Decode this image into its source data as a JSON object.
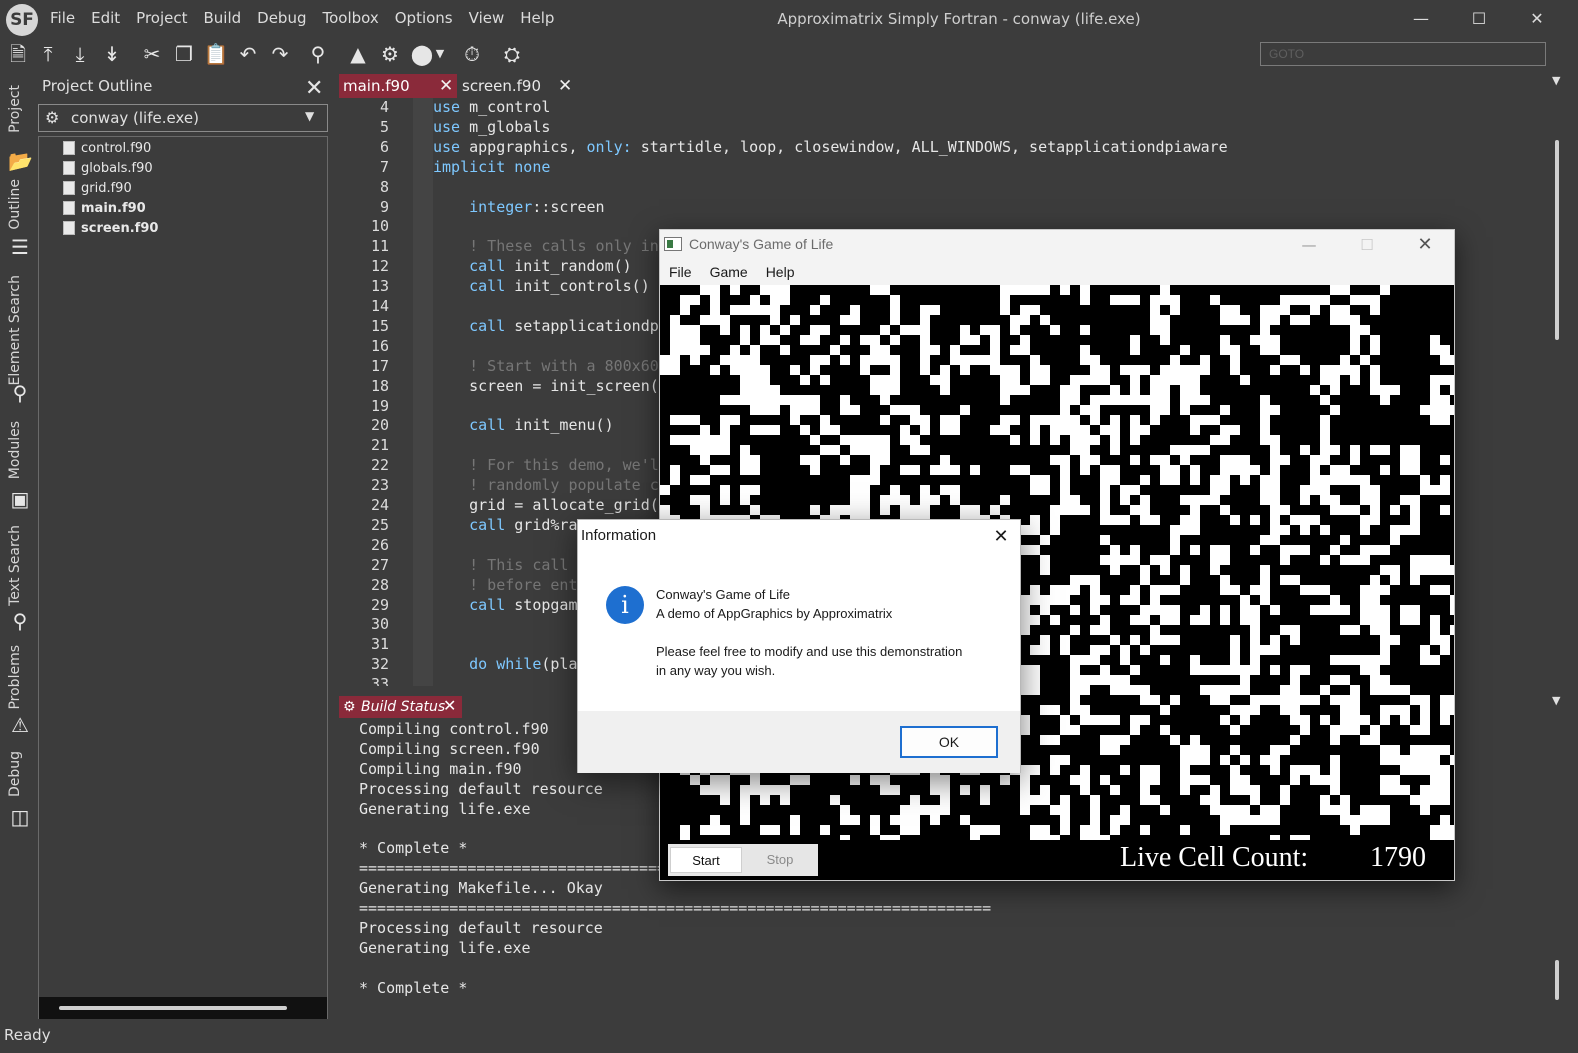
{
  "app": {
    "logo_text": "SF",
    "window_title": "Approximatrix Simply Fortran - conway (life.exe)",
    "menu": [
      "File",
      "Edit",
      "Project",
      "Build",
      "Debug",
      "Toolbox",
      "Options",
      "View",
      "Help"
    ],
    "goto_placeholder": "GOTO",
    "status": "Ready",
    "colors": {
      "background": "#3c3c3c",
      "active_tab": "#8a2a3a",
      "keyword": "#7ec8ff",
      "comment": "#767676"
    }
  },
  "toolbar": {
    "icons": [
      "new-file-icon",
      "upload-icon",
      "download-icon",
      "download-all-icon",
      "cut-icon",
      "copy-icon",
      "paste-icon",
      "undo-icon",
      "redo-icon",
      "search-icon",
      "clean-icon",
      "build-gear-icon",
      "stop-icon",
      "dropdown-arrow-icon",
      "run-icon",
      "debug-bug-icon"
    ]
  },
  "side_tabs": [
    "Project",
    "Outline",
    "Element Search",
    "Modules",
    "Text Search",
    "Problems",
    "Debug"
  ],
  "project_outline": {
    "title": "Project Outline",
    "project": "conway (life.exe)",
    "files": [
      {
        "name": "control.f90",
        "bold": false
      },
      {
        "name": "globals.f90",
        "bold": false
      },
      {
        "name": "grid.f90",
        "bold": false
      },
      {
        "name": "main.f90",
        "bold": true
      },
      {
        "name": "screen.f90",
        "bold": true
      }
    ]
  },
  "editor": {
    "tabs": [
      {
        "label": "main.f90",
        "active": true
      },
      {
        "label": "screen.f90",
        "active": false
      }
    ],
    "lines": [
      {
        "n": "4",
        "segs": [
          {
            "t": "use",
            "c": "kw"
          },
          {
            "t": " m_control",
            "c": ""
          }
        ]
      },
      {
        "n": "5",
        "segs": [
          {
            "t": "use",
            "c": "kw"
          },
          {
            "t": " m_globals",
            "c": ""
          }
        ]
      },
      {
        "n": "6",
        "segs": [
          {
            "t": "use",
            "c": "kw"
          },
          {
            "t": " appgraphics, ",
            "c": ""
          },
          {
            "t": "only:",
            "c": "kw"
          },
          {
            "t": " startidle, loop, closewindow, ALL_WINDOWS, setapplicationdpiaware",
            "c": ""
          }
        ]
      },
      {
        "n": "7",
        "segs": [
          {
            "t": "implicit none",
            "c": "kw"
          }
        ]
      },
      {
        "n": "8",
        "segs": []
      },
      {
        "n": "9",
        "segs": [
          {
            "t": "    ",
            "c": ""
          },
          {
            "t": "integer",
            "c": "kw"
          },
          {
            "t": "::screen",
            "c": ""
          }
        ]
      },
      {
        "n": "10",
        "segs": []
      },
      {
        "n": "11",
        "segs": [
          {
            "t": "    ! These calls only in",
            "c": "cmt"
          }
        ]
      },
      {
        "n": "12",
        "segs": [
          {
            "t": "    ",
            "c": ""
          },
          {
            "t": "call",
            "c": "kw"
          },
          {
            "t": " init_random()",
            "c": ""
          }
        ]
      },
      {
        "n": "13",
        "segs": [
          {
            "t": "    ",
            "c": ""
          },
          {
            "t": "call",
            "c": "kw"
          },
          {
            "t": " init_controls()",
            "c": ""
          }
        ]
      },
      {
        "n": "14",
        "segs": []
      },
      {
        "n": "15",
        "segs": [
          {
            "t": "    ",
            "c": ""
          },
          {
            "t": "call",
            "c": "kw"
          },
          {
            "t": " setapplicationdp",
            "c": ""
          }
        ]
      },
      {
        "n": "16",
        "segs": []
      },
      {
        "n": "17",
        "segs": [
          {
            "t": "    ! Start with a 800x600",
            "c": "cmt"
          }
        ]
      },
      {
        "n": "18",
        "segs": [
          {
            "t": "    screen = init_screen(",
            "c": ""
          }
        ]
      },
      {
        "n": "19",
        "segs": []
      },
      {
        "n": "20",
        "segs": [
          {
            "t": "    ",
            "c": ""
          },
          {
            "t": "call",
            "c": "kw"
          },
          {
            "t": " init_menu()",
            "c": ""
          }
        ]
      },
      {
        "n": "21",
        "segs": []
      },
      {
        "n": "22",
        "segs": [
          {
            "t": "    ! For this demo, we'l",
            "c": "cmt"
          }
        ]
      },
      {
        "n": "23",
        "segs": [
          {
            "t": "    ! randomly populate c",
            "c": "cmt"
          }
        ]
      },
      {
        "n": "24",
        "segs": [
          {
            "t": "    grid = allocate_grid(",
            "c": ""
          }
        ]
      },
      {
        "n": "25",
        "segs": [
          {
            "t": "    ",
            "c": ""
          },
          {
            "t": "call",
            "c": "kw"
          },
          {
            "t": " grid%ra",
            "c": ""
          }
        ]
      },
      {
        "n": "26",
        "segs": []
      },
      {
        "n": "27",
        "segs": [
          {
            "t": "    ! This call",
            "c": "cmt"
          }
        ]
      },
      {
        "n": "28",
        "segs": [
          {
            "t": "    ! before ent",
            "c": "cmt"
          }
        ]
      },
      {
        "n": "29",
        "segs": [
          {
            "t": "    ",
            "c": ""
          },
          {
            "t": "call",
            "c": "kw"
          },
          {
            "t": " stopgame",
            "c": ""
          }
        ]
      },
      {
        "n": "30",
        "segs": []
      },
      {
        "n": "31",
        "segs": []
      },
      {
        "n": "32",
        "segs": [
          {
            "t": "    ",
            "c": ""
          },
          {
            "t": "do while",
            "c": "kw"
          },
          {
            "t": "(pla",
            "c": ""
          }
        ]
      },
      {
        "n": "33",
        "segs": []
      }
    ]
  },
  "build": {
    "tab_label": "Build Status",
    "lines": [
      "Compiling control.f90",
      "Compiling screen.f90",
      "Compiling main.f90",
      "Processing default resource",
      "Generating life.exe",
      "",
      "* Complete *",
      "====================================",
      "Generating Makefile... Okay",
      "======================================================================",
      "Processing default resource",
      "Generating life.exe",
      "",
      "* Complete *"
    ]
  },
  "life_window": {
    "title": "Conway's Game of Life",
    "menu": [
      "File",
      "Game",
      "Help"
    ],
    "start_label": "Start",
    "stop_label": "Stop",
    "count_label": "Live Cell Count:",
    "count_value": "1790"
  },
  "info_dialog": {
    "title": "Information",
    "lines": [
      "Conway's Game of Life",
      "A demo of AppGraphics by Approximatrix",
      "",
      "Please feel free to modify and use this demonstration",
      "in any way you wish."
    ],
    "ok_label": "OK"
  }
}
